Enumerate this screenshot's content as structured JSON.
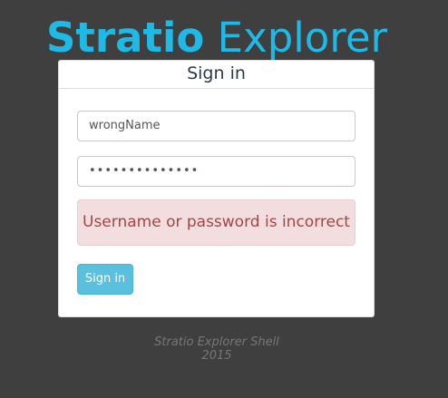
{
  "brand": {
    "strong": "Stratio",
    "light": "Explorer"
  },
  "login": {
    "heading": "Sign in",
    "username_value": "wrongName",
    "password_value": "••••••••••••••",
    "error_message": "Username or password is incorrect",
    "submit_label": "Sign in"
  },
  "footer": {
    "line1": "Stratio Explorer Shell",
    "line2": "2015"
  },
  "colors": {
    "background": "#3f3f3f",
    "brand": "#1fb9e6",
    "alert_bg": "#f2dede",
    "alert_text": "#a94442",
    "button": "#5bc0de"
  }
}
